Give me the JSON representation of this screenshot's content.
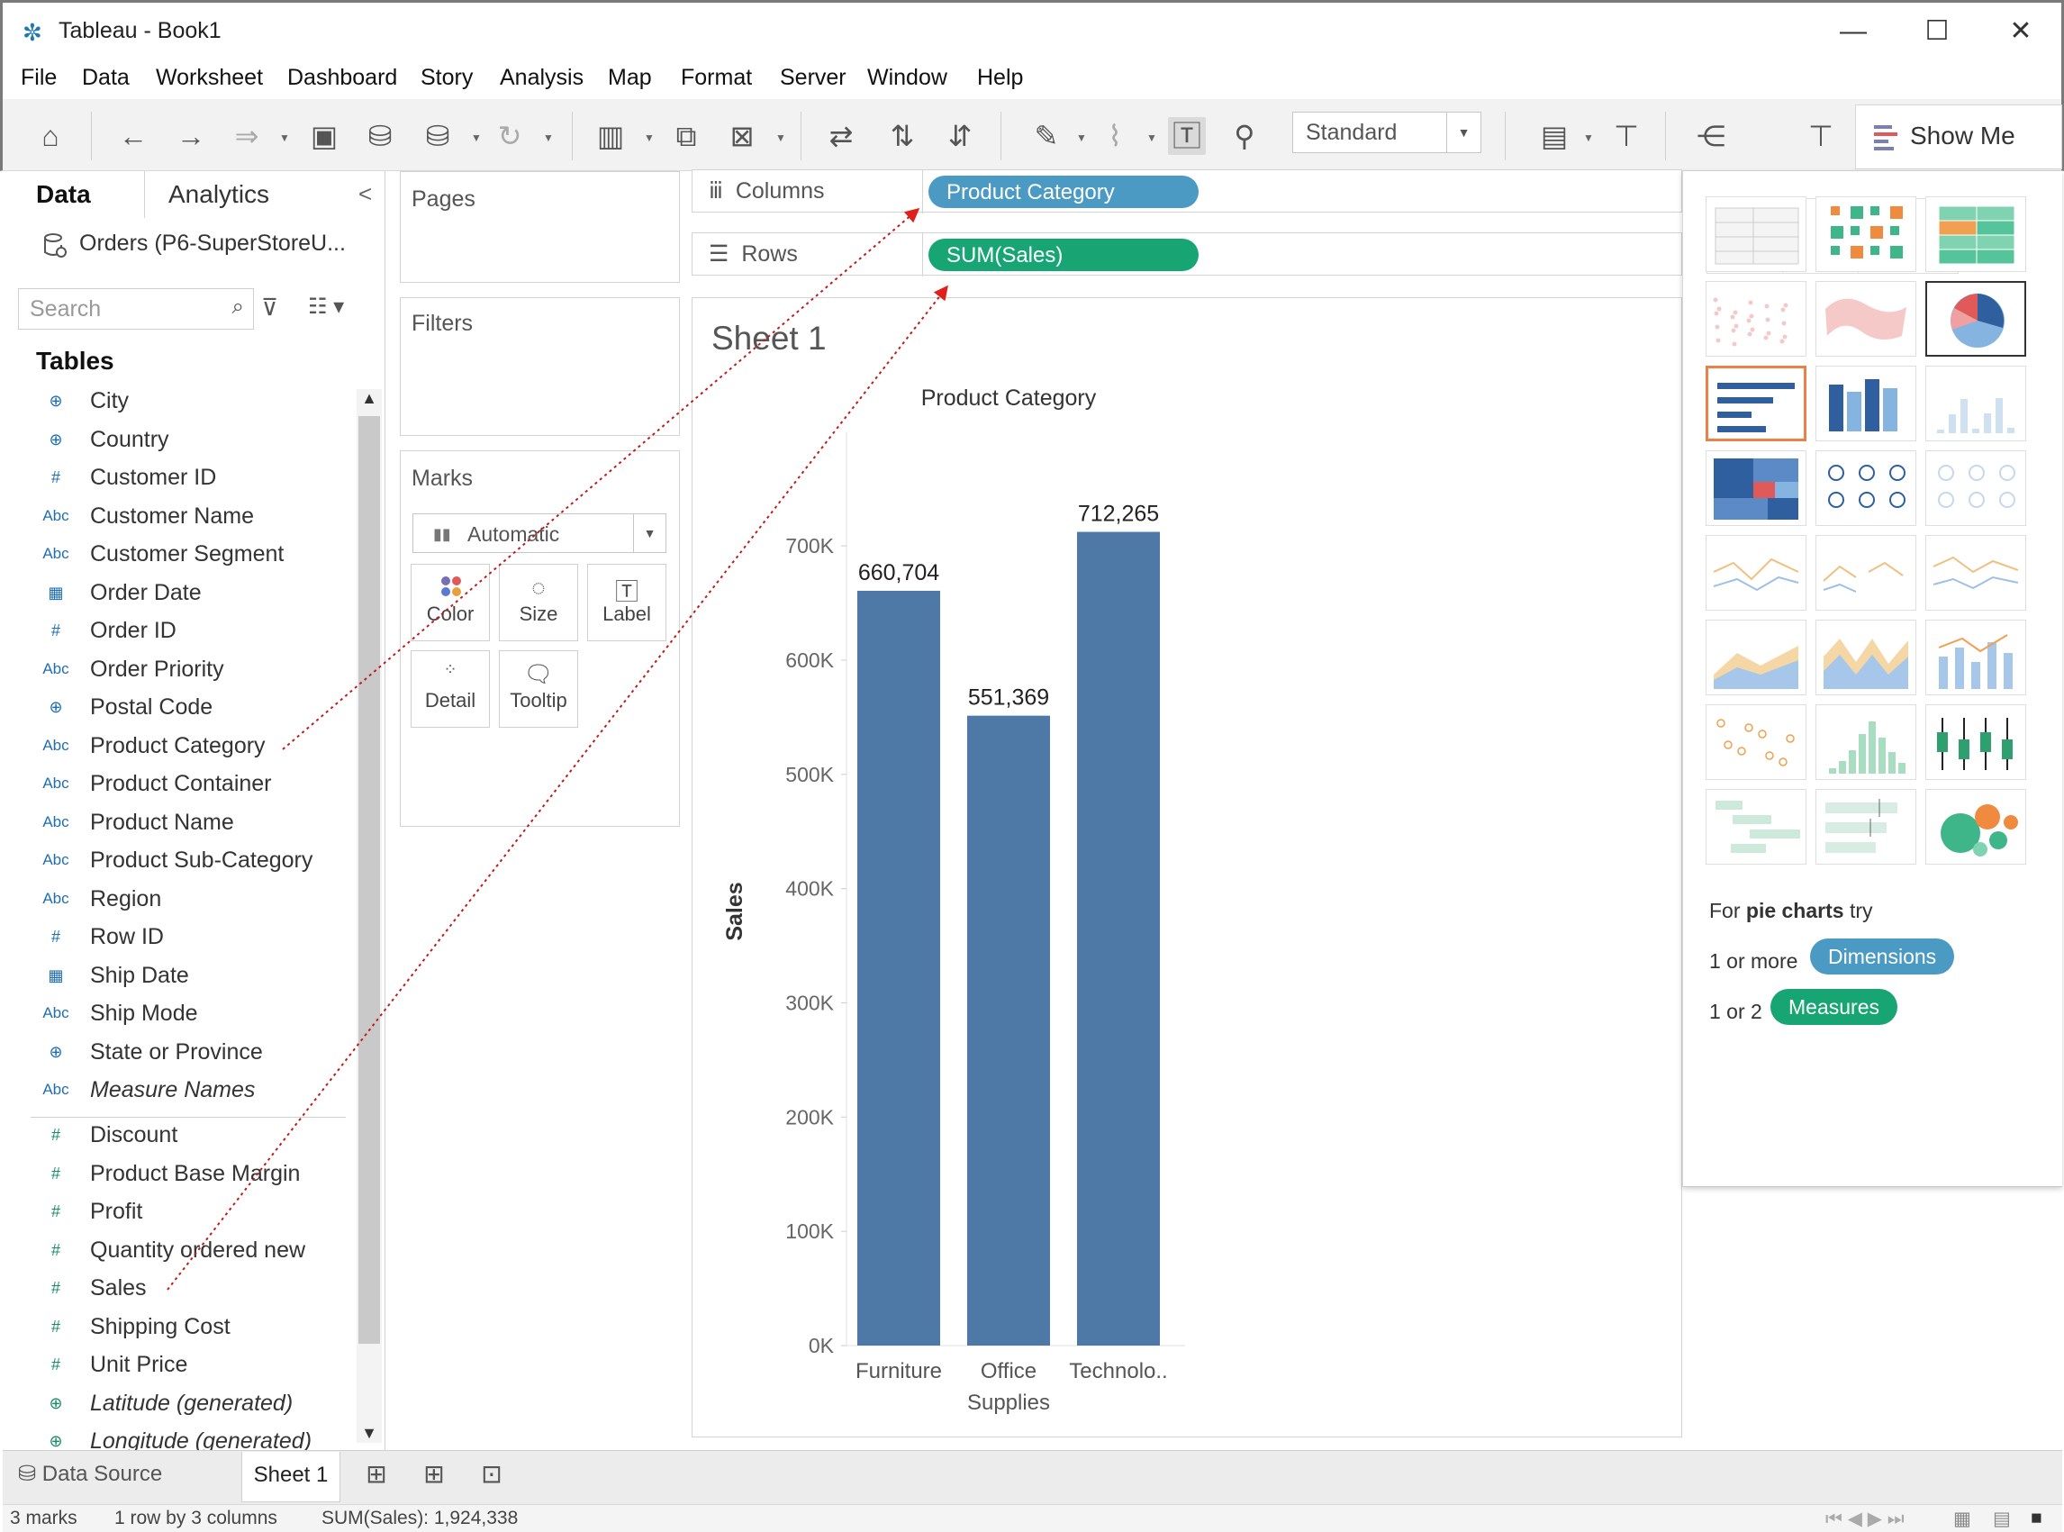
{
  "window": {
    "title": "Tableau - Book1",
    "minimize": "—",
    "maximize": "☐",
    "close": "✕"
  },
  "menu": [
    "File",
    "Data",
    "Worksheet",
    "Dashboard",
    "Story",
    "Analysis",
    "Map",
    "Format",
    "Server",
    "Window",
    "Help"
  ],
  "toolbar": {
    "fit_select": "Standard",
    "show_me": "Show Me"
  },
  "data_pane": {
    "tab_data": "Data",
    "tab_analytics": "Analytics",
    "collapse": "<",
    "datasource": "Orders (P6-SuperStoreU...",
    "search_placeholder": "Search",
    "tables_header": "Tables",
    "fields": [
      {
        "icon": "⊕",
        "type": "geo",
        "name": "City"
      },
      {
        "icon": "⊕",
        "type": "geo",
        "name": "Country"
      },
      {
        "icon": "#",
        "type": "dim",
        "name": "Customer ID"
      },
      {
        "icon": "Abc",
        "type": "dim",
        "name": "Customer Name"
      },
      {
        "icon": "Abc",
        "type": "dim",
        "name": "Customer Segment"
      },
      {
        "icon": "▦",
        "type": "dim",
        "name": "Order Date"
      },
      {
        "icon": "#",
        "type": "dim",
        "name": "Order ID"
      },
      {
        "icon": "Abc",
        "type": "dim",
        "name": "Order Priority"
      },
      {
        "icon": "⊕",
        "type": "geo",
        "name": "Postal Code"
      },
      {
        "icon": "Abc",
        "type": "dim",
        "name": "Product Category"
      },
      {
        "icon": "Abc",
        "type": "dim",
        "name": "Product Container"
      },
      {
        "icon": "Abc",
        "type": "dim",
        "name": "Product Name"
      },
      {
        "icon": "Abc",
        "type": "dim",
        "name": "Product Sub-Category"
      },
      {
        "icon": "Abc",
        "type": "dim",
        "name": "Region"
      },
      {
        "icon": "#",
        "type": "dim",
        "name": "Row ID"
      },
      {
        "icon": "▦",
        "type": "dim",
        "name": "Ship Date"
      },
      {
        "icon": "Abc",
        "type": "dim",
        "name": "Ship Mode"
      },
      {
        "icon": "⊕",
        "type": "geo",
        "name": "State or Province"
      },
      {
        "icon": "Abc",
        "type": "dim",
        "name": "Measure Names",
        "italic": true
      }
    ],
    "measures": [
      {
        "icon": "#",
        "name": "Discount"
      },
      {
        "icon": "#",
        "name": "Product Base Margin"
      },
      {
        "icon": "#",
        "name": "Profit"
      },
      {
        "icon": "#",
        "name": "Quantity ordered new"
      },
      {
        "icon": "#",
        "name": "Sales"
      },
      {
        "icon": "#",
        "name": "Shipping Cost"
      },
      {
        "icon": "#",
        "name": "Unit Price"
      },
      {
        "icon": "⊕",
        "name": "Latitude (generated)",
        "italic": true
      },
      {
        "icon": "⊕",
        "name": "Longitude (generated)",
        "italic": true
      }
    ]
  },
  "cards": {
    "pages": "Pages",
    "filters": "Filters",
    "marks": "Marks",
    "mark_type": "Automatic",
    "mark_buttons": [
      "Color",
      "Size",
      "Label",
      "Detail",
      "Tooltip"
    ]
  },
  "shelves": {
    "columns_label": "Columns",
    "rows_label": "Rows",
    "columns_pill": "Product Category",
    "rows_pill": "SUM(Sales)"
  },
  "sheet": {
    "title": "Sheet 1"
  },
  "chart_data": {
    "type": "bar",
    "title": "Product Category",
    "ylabel": "Sales",
    "xlabel": "",
    "categories": [
      "Furniture",
      "Office Supplies",
      "Technolo.."
    ],
    "category_lines": [
      [
        "Furniture"
      ],
      [
        "Office",
        "Supplies"
      ],
      [
        "Technolo.."
      ]
    ],
    "values": [
      660704,
      551369,
      712265
    ],
    "value_labels": [
      "660,704",
      "551,369",
      "712,265"
    ],
    "ylim": [
      0,
      760000
    ],
    "yticks": [
      0,
      100000,
      200000,
      300000,
      400000,
      500000,
      600000,
      700000
    ],
    "ytick_labels": [
      "0K",
      "100K",
      "200K",
      "300K",
      "400K",
      "500K",
      "600K",
      "700K"
    ],
    "bar_color": "#4e79a7",
    "grid": false
  },
  "show_me": {
    "hint_prefix": "For",
    "hint_bold": "pie charts",
    "hint_suffix": "try",
    "req1_label": "1 or more",
    "req1_pill": "Dimensions",
    "req2_label": "1 or 2",
    "req2_pill": "Measures"
  },
  "bottom": {
    "data_source_tab": "Data Source",
    "sheet_tab": "Sheet 1"
  },
  "status": {
    "marks": "3 marks",
    "dims": "1 row by 3 columns",
    "sum": "SUM(Sales): 1,924,338"
  },
  "colors": {
    "dimension": "#4b9ac4",
    "measure": "#17a673",
    "bar": "#4e79a7",
    "selected": "#e8824b"
  }
}
